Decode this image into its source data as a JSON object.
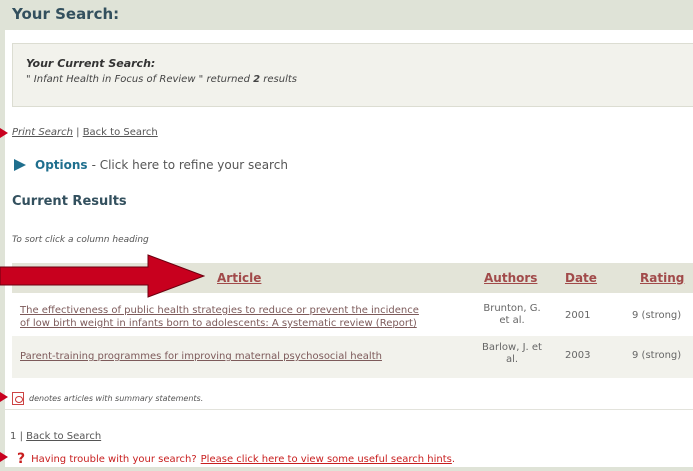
{
  "header": {
    "title": "Your Search:"
  },
  "search": {
    "label": "Your Current Search:",
    "query_prefix": "\" Infant Health in Focus of Review \" returned",
    "count": "2",
    "query_suffix": "results"
  },
  "links": {
    "print": "Print Search",
    "sep": "|",
    "back": "Back to Search"
  },
  "options": {
    "label": "Options",
    "text": "- Click here to refine your search"
  },
  "results": {
    "heading": "Current Results",
    "sort_hint": "To sort click a column heading",
    "columns": [
      "Article",
      "Authors",
      "Date",
      "Rating"
    ],
    "rows": [
      {
        "title_line1": "The effectiveness of public health strategies to reduce or prevent the incidence",
        "title_line2": "of low birth weight in infants born to adolescents: A systematic review (Report)",
        "author_line1": "Brunton, G.",
        "author_line2": "et al.",
        "date": "2001",
        "rating": "9 (strong)"
      },
      {
        "title_line1": "Parent-training programmes for improving maternal psychosocial health",
        "author_line1": "Barlow, J. et",
        "author_line2": "al.",
        "date": "2003",
        "rating": "9 (strong)"
      }
    ]
  },
  "footnote": {
    "pdf_note": "denotes articles with summary statements."
  },
  "pager": {
    "page": "1",
    "sep": "|",
    "back": "Back to Search"
  },
  "help": {
    "icon": "question-mark-icon",
    "text": "Having trouble with your search?",
    "link": "Please click here to view some useful search hints",
    "end": "."
  },
  "colors": {
    "accent": "#1f6f8e",
    "heading": "#33505e",
    "column_link": "#a14a4a",
    "alert": "#c81e1e",
    "arrow": "#c8001e"
  }
}
